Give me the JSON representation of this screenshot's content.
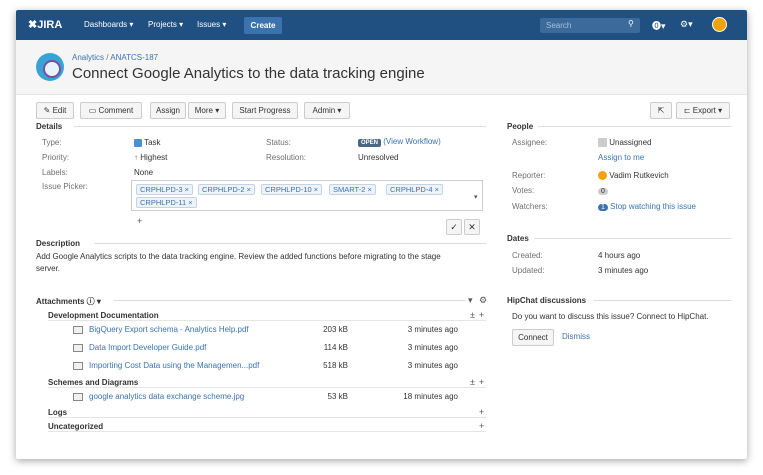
{
  "topbar": {
    "logo": "JIRA",
    "nav": [
      "Dashboards ▾",
      "Projects ▾",
      "Issues ▾"
    ],
    "create": "Create",
    "search_placeholder": "Search"
  },
  "header": {
    "breadcrumb_project": "Analytics",
    "breadcrumb_sep": "/",
    "breadcrumb_issue": "ANATCS-187",
    "title": "Connect Google Analytics to the data tracking engine"
  },
  "toolbar": {
    "edit": "Edit",
    "comment": "Comment",
    "assign": "Assign",
    "more": "More ▾",
    "start_progress": "Start Progress",
    "admin": "Admin ▾",
    "export": "Export ▾"
  },
  "details": {
    "heading": "Details",
    "type_label": "Type:",
    "type_value": "Task",
    "priority_label": "Priority:",
    "priority_value": "Highest",
    "labels_label": "Labels:",
    "labels_value": "None",
    "status_label": "Status:",
    "status_badge": "OPEN",
    "status_link": "(View Workflow)",
    "resolution_label": "Resolution:",
    "resolution_value": "Unresolved",
    "picker_label": "Issue Picker:",
    "picker_chips": [
      "CRPHLPD-3 ×",
      "CRPHLPD-2 ×",
      "CRPHLPD-10 ×",
      "SMART-2 ×",
      "CRPHLPD-4 ×",
      "CRPHLPD-11 ×"
    ],
    "picker_add": "+"
  },
  "description": {
    "heading": "Description",
    "text": "Add Google Analytics scripts to the data tracking engine. Review the added functions before migrating to the stage server."
  },
  "attachments": {
    "heading": "Attachments ⓘ ▾",
    "groups": [
      {
        "name": "Development Documentation",
        "files": [
          {
            "name": "BigQuery Export schema - Analytics Help.pdf",
            "size": "203 kB",
            "date": "3 minutes ago"
          },
          {
            "name": "Data Import Developer Guide.pdf",
            "size": "114 kB",
            "date": "3 minutes ago"
          },
          {
            "name": "Importing Cost Data using the Managemen...pdf",
            "size": "518 kB",
            "date": "3 minutes ago"
          }
        ]
      },
      {
        "name": "Schemes and Diagrams",
        "files": [
          {
            "name": "google analytics data exchange scheme.jpg",
            "size": "53 kB",
            "date": "18 minutes ago"
          }
        ]
      },
      {
        "name": "Logs",
        "files": []
      },
      {
        "name": "Uncategorized",
        "files": []
      }
    ]
  },
  "people": {
    "heading": "People",
    "assignee_label": "Assignee:",
    "assignee_value": "Unassigned",
    "assign_to_me": "Assign to me",
    "reporter_label": "Reporter:",
    "reporter_value": "Vadim Rutkevich",
    "votes_label": "Votes:",
    "votes_value": "0",
    "watchers_label": "Watchers:",
    "watchers_count": "1",
    "watchers_link": "Stop watching this issue"
  },
  "dates": {
    "heading": "Dates",
    "created_label": "Created:",
    "created_value": "4 hours ago",
    "updated_label": "Updated:",
    "updated_value": "3 minutes ago"
  },
  "hipchat": {
    "heading": "HipChat discussions",
    "text": "Do you want to discuss this issue? Connect to HipChat.",
    "connect": "Connect",
    "dismiss": "Dismiss"
  },
  "colors": {
    "topbar": "#205081",
    "link": "#3b73af",
    "accent": "#f0a30a"
  }
}
